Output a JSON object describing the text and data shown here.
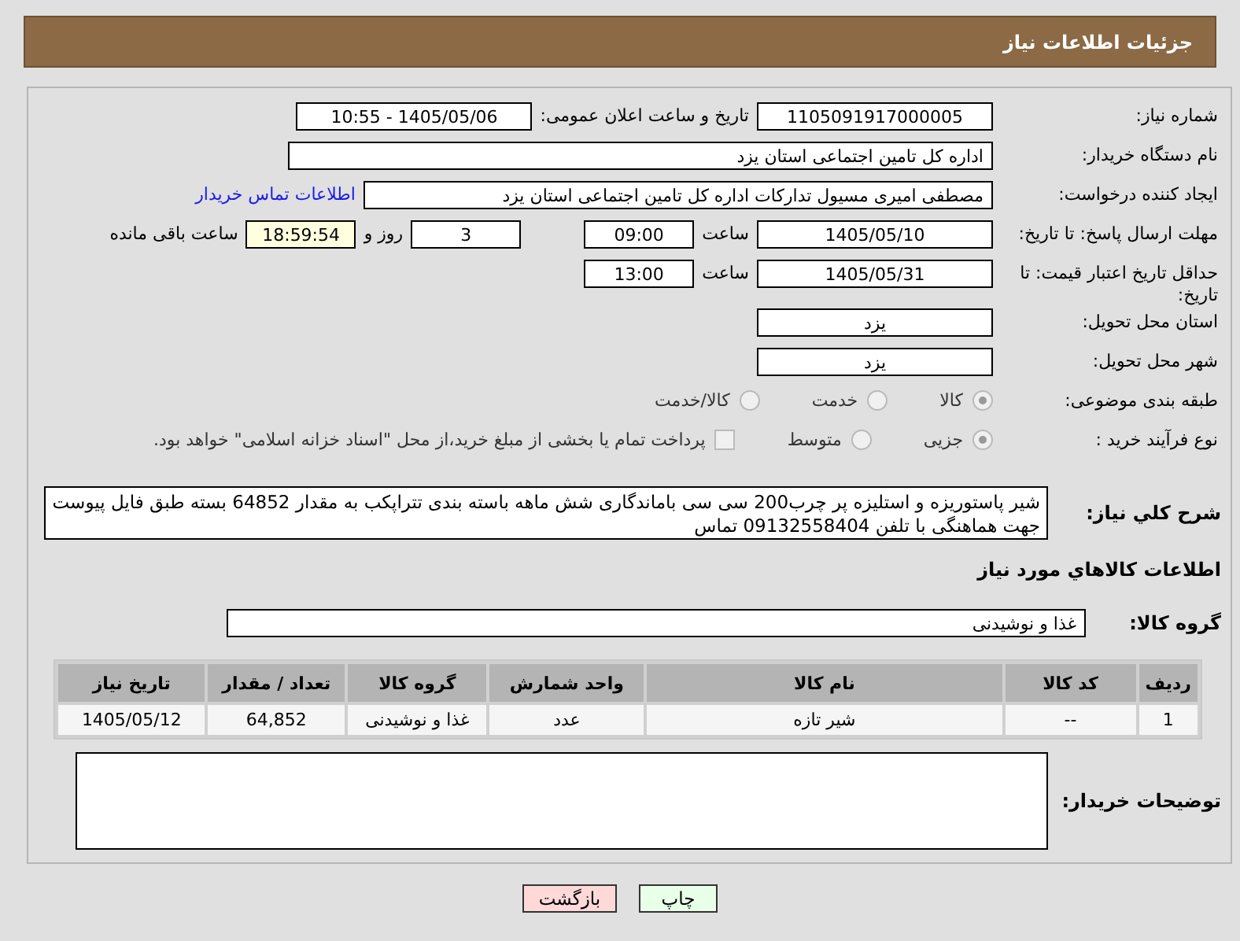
{
  "header": {
    "title": "جزئیات اطلاعات نیاز"
  },
  "rows": [
    {
      "label": "شماره نیاز:",
      "items": [
        {
          "kind": "field",
          "value": "1105091917000005"
        },
        {
          "kind": "text",
          "value": "تاریخ و ساعت اعلان عمومی:"
        },
        {
          "kind": "field",
          "value": "1405/05/06 - 10:55"
        }
      ]
    },
    {
      "label": "نام دستگاه خریدار:",
      "items": [
        {
          "kind": "wide_field",
          "value": "اداره کل تامین اجتماعی استان یزد"
        }
      ]
    },
    {
      "label": "ایجاد کننده درخواست:",
      "items": [
        {
          "kind": "medium_field",
          "value": "مصطفی امیری مسیول تدارکات اداره کل تامین اجتماعی استان یزد"
        },
        {
          "kind": "link",
          "value": "اطلاعات تماس خریدار"
        }
      ]
    },
    {
      "label": "مهلت ارسال پاسخ: تا تاریخ:",
      "items": [
        {
          "kind": "field",
          "value": "1405/05/10"
        },
        {
          "kind": "text",
          "value": "ساعت"
        },
        {
          "kind": "small_field",
          "value": "09:00"
        },
        {
          "kind": "gap"
        },
        {
          "kind": "small_field",
          "value": "3"
        },
        {
          "kind": "text",
          "value": "روز و"
        },
        {
          "kind": "timer_field",
          "value": "18:59:54"
        },
        {
          "kind": "text",
          "value": "ساعت باقی مانده"
        }
      ]
    },
    {
      "label": "حداقل تاریخ اعتبار قیمت: تا تاریخ:",
      "items": [
        {
          "kind": "field",
          "value": "1405/05/31"
        },
        {
          "kind": "text",
          "value": "ساعت"
        },
        {
          "kind": "small_field",
          "value": "13:00"
        }
      ]
    },
    {
      "label": "استان محل تحویل:",
      "items": [
        {
          "kind": "field",
          "value": "یزد"
        }
      ]
    },
    {
      "label": "شهر محل تحویل:",
      "items": [
        {
          "kind": "field",
          "value": "یزد"
        }
      ]
    },
    {
      "label": "طبقه بندی موضوعی:",
      "items": [
        {
          "kind": "radio",
          "value": "کالا",
          "selected": true
        },
        {
          "kind": "radio",
          "value": "خدمت",
          "selected": false
        },
        {
          "kind": "radio",
          "value": "کالا/خدمت",
          "selected": false
        }
      ]
    },
    {
      "label": "نوع فرآیند خرید :",
      "items": [
        {
          "kind": "radio",
          "value": "جزیی",
          "selected": true
        },
        {
          "kind": "radio",
          "value": "متوسط",
          "selected": false
        },
        {
          "kind": "checkbox",
          "value": "پرداخت تمام یا بخشی از مبلغ خرید،از محل \"اسناد خزانه اسلامی\" خواهد بود.",
          "checked": false
        }
      ]
    }
  ],
  "description": {
    "label": "شرح کلي نياز:",
    "value": "شیر پاستوریزه و استلیزه پر چرب200 سی سی باماندگاری شش ماهه باسته بندی تتراپکب به مقدار 64852 بسته طبق فایل پیوست جهت هماهنگی با تلفن 09132558404 تماس"
  },
  "goods_section": {
    "title": "اطلاعات کالاهاي مورد نياز",
    "group_label": "گروه کالا:",
    "group_value": "غذا و نوشیدنی"
  },
  "table": {
    "columns": [
      "ردیف",
      "کد کالا",
      "نام کالا",
      "واحد شمارش",
      "گروه کالا",
      "تعداد / مقدار",
      "تاریخ نیاز"
    ],
    "rows": [
      [
        "1",
        "--",
        "شیر تازه",
        "عدد",
        "غذا و نوشیدنی",
        "64,852",
        "1405/05/12"
      ]
    ]
  },
  "buyer_notes": {
    "label": "توضیحات خریدار:"
  },
  "buttons": [
    {
      "label": "چاپ",
      "kind": "print"
    },
    {
      "label": "بازگشت",
      "kind": "back"
    }
  ]
}
